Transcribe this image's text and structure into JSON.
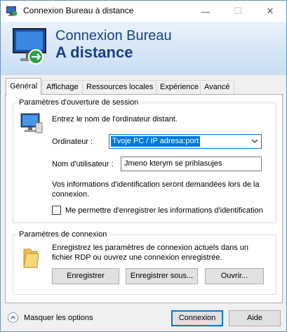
{
  "window": {
    "title": "Connexion Bureau à distance",
    "controls": {
      "minimize": "—",
      "maximize": "☐",
      "close": "✕"
    }
  },
  "banner": {
    "line1": "Connexion Bureau",
    "line2": "A distance",
    "icon": "remote-desktop-monitor-icon"
  },
  "tabs": [
    {
      "label": "Général",
      "active": true
    },
    {
      "label": "Affichage",
      "active": false
    },
    {
      "label": "Ressources locales",
      "active": false
    },
    {
      "label": "Expérience",
      "active": false
    },
    {
      "label": "Avancé",
      "active": false
    }
  ],
  "logon": {
    "group_title": "Paramètres d'ouverture de session",
    "instruction": "Entrez le nom de l'ordinateur distant.",
    "computer_label": "Ordinateur :",
    "computer_value": "Tvoje  PC / IP adresa:port",
    "username_label": "Nom d'utilisateur :",
    "username_value": "Jmeno kterym se prihlasujes",
    "info_text": "Vos informations d'identification seront demandées lors de la connexion.",
    "save_credentials_label": "Me permettre d'enregistrer les informations d'identification",
    "save_credentials_checked": false
  },
  "connection": {
    "group_title": "Paramètres de connexion",
    "description": "Enregistrez les paramètres de connexion actuels dans un fichier RDP ou ouvrez une connexion enregistrée.",
    "save_button": "Enregistrer",
    "save_as_button": "Enregistrer sous...",
    "open_button": "Ouvrir..."
  },
  "footer": {
    "toggle_label": "Masquer les options",
    "connect_button": "Connexion",
    "help_button": "Aide"
  }
}
